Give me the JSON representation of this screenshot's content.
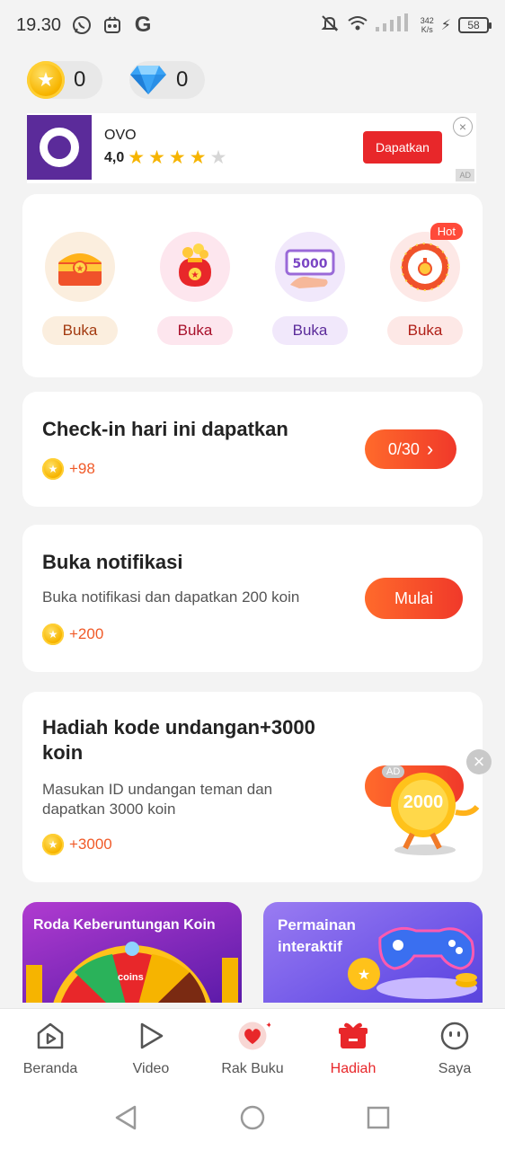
{
  "status_bar": {
    "time": "19.30",
    "net_speed_value": "342",
    "net_speed_unit": "K/s",
    "battery": "58"
  },
  "wallet": {
    "coins": "0",
    "diamonds": "0"
  },
  "ad": {
    "app_name": "OVO",
    "rating": "4,0",
    "stars": 4,
    "button": "Dapatkan",
    "tag": "AD",
    "close": "×"
  },
  "boxes": {
    "hot_badge": "Hot",
    "items": [
      {
        "label": "Buka",
        "icon": "treasure-chest-icon",
        "bg": "#fbeede",
        "btn_bg": "#fbeede",
        "color": "#a33a10"
      },
      {
        "label": "Buka",
        "icon": "money-bag-icon",
        "bg": "#fde6ee",
        "btn_bg": "#fde6ee",
        "color": "#a8102a"
      },
      {
        "label": "Buka",
        "icon": "voucher-5000-icon",
        "bg": "#f1e8fb",
        "btn_bg": "#f1e8fb",
        "color": "#5b2b9a"
      },
      {
        "label": "Buka",
        "icon": "lucky-wheel-icon",
        "bg": "#fde8e6",
        "btn_bg": "#fde8e6",
        "color": "#b02018"
      }
    ],
    "voucher_text": "5000"
  },
  "checkin": {
    "title": "Check-in hari ini dapatkan",
    "reward": "+98",
    "button": "0/30",
    "chevron": "›"
  },
  "notification": {
    "title": "Buka notifikasi",
    "description": "Buka notifikasi dan dapatkan 200 koin",
    "reward": "+200",
    "button": "Mulai"
  },
  "invite": {
    "title_line1": "Hadiah kode undangan+3000",
    "title_line2": "koin",
    "desc_line1": "Masukan ID undangan teman dan",
    "desc_line2": "dapatkan 3000 koin",
    "reward": "+3000",
    "ad_tag": "AD",
    "mascot_value": "2000",
    "close": "×"
  },
  "promos": {
    "left_title": "Roda Keberuntungan Koin",
    "wheel_text": "coins",
    "right_title_line1": "Permainan",
    "right_title_line2": "interaktif"
  },
  "bottom_nav": [
    {
      "label": "Beranda",
      "icon": "home-play-icon"
    },
    {
      "label": "Video",
      "icon": "video-play-icon"
    },
    {
      "label": "Rak Buku",
      "icon": "bookshelf-heart-icon"
    },
    {
      "label": "Hadiah",
      "icon": "gift-icon",
      "active": true
    },
    {
      "label": "Saya",
      "icon": "profile-face-icon"
    }
  ],
  "colors": {
    "accent": "#e8272a",
    "orange": "#f05a28",
    "coin": "#f7b500"
  }
}
